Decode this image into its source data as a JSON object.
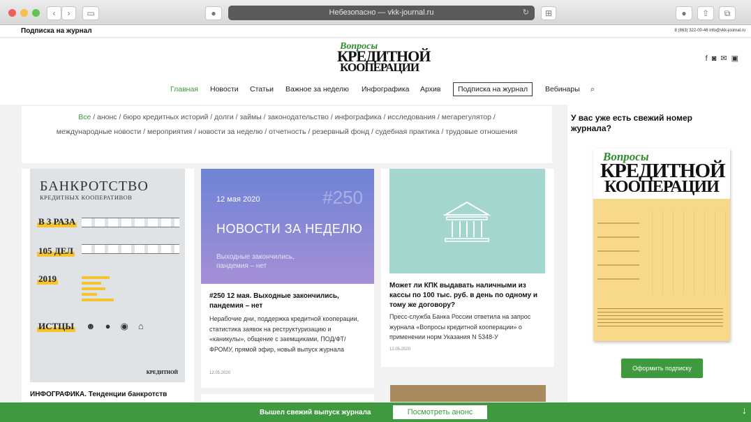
{
  "browser": {
    "address": "Небезопасно — vkk-journal.ru",
    "reload_icon": "↻"
  },
  "site": {
    "topbar_title": "Подписка на журнал",
    "contact": "8 (863) 322-00-46 info@vkk-journal.ru",
    "logo": {
      "line1": "Вопросы",
      "line2": "КРЕДИТНОЙ",
      "line3": "КООПЕРАЦИИ"
    },
    "social_icons": [
      "facebook-icon",
      "instagram-icon",
      "mail-icon",
      "youtube-icon"
    ]
  },
  "nav": [
    {
      "label": "Главная",
      "active": true
    },
    {
      "label": "Новости"
    },
    {
      "label": "Статьи"
    },
    {
      "label": "Важное за неделю"
    },
    {
      "label": "Инфографика"
    },
    {
      "label": "Архив"
    },
    {
      "label": "Подписка на журнал",
      "boxed": true
    },
    {
      "label": "Вебинары"
    }
  ],
  "tags": {
    "first": "Все",
    "rest": " / анонс / бюро кредитных историй / долги / займы / законодательство / инфографика / исследования / мегарегулятор / международные новости / мероприятия / новости за неделю / отчетность / резервный фонд / судебная практика / трудовые отношения"
  },
  "card1": {
    "info_title": "БАНКРОТСТВО",
    "info_subtitle": "КРЕДИТНЫХ КООПЕРАТИВОВ",
    "h1": "В 3 РАЗА",
    "h2": "105 ДЕЛ",
    "h3": "2019",
    "h4": "ИСТЦЫ",
    "stamp": "КРЕДИТНОЙ",
    "caption": "ИНФОГРАФИКА. Тенденции банкротств"
  },
  "card2": {
    "date": "12 мая 2020",
    "number": "#250",
    "banner_title": "НОВОСТИ ЗА НЕДЕЛЮ",
    "banner_sub": "Выходные закончились, пандемия – нет",
    "title": "#250 12 мая. Выходные закончились, пандемия – нет",
    "text": "Нерабочие дни, поддержка кредитной кооперации, статистика заявок на реструктуризацию и «каникулы», общение с заемщиками, ПОД/ФТ/ФРОМУ, прямой эфир, новый выпуск журнала",
    "posted": "12.05.2020"
  },
  "card3": {
    "title": "Может ли КПК выдавать наличными из кассы по 100 тыс. руб. в день по одному и тому же договору?",
    "text": "Пресс-служба Банка России ответила на запрос журнала «Вопросы кредитной кооперации» о применении норм Указания N 5348-У",
    "posted": "12.05.2020"
  },
  "sidebar": {
    "question": "У вас уже есть свежий номер журнала?",
    "cover": {
      "line1": "Вопросы",
      "line2": "КРЕДИТНОЙ",
      "line3": "КООПЕРАЦИИ"
    },
    "subscribe": "Оформить подписку"
  },
  "banner": {
    "text": "Вышел свежий выпуск журнала",
    "button": "Посмотреть анонс",
    "arrow": "↓"
  },
  "colors": {
    "accent": "#3f9a3f",
    "teal": "#a3d6cf",
    "violet": "#7a88d8"
  }
}
